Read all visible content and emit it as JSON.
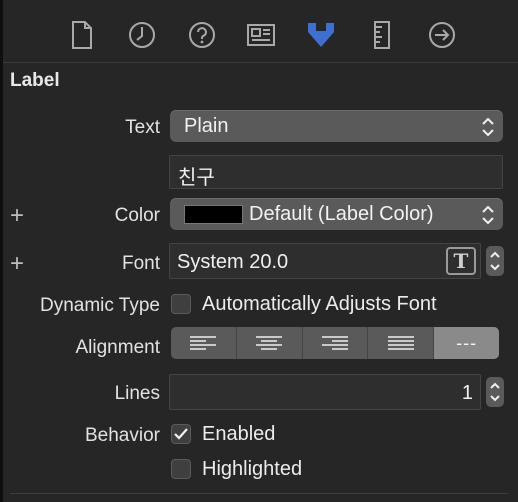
{
  "toolbar": {
    "icons": [
      "file-icon",
      "history-icon",
      "help-icon",
      "identity-icon",
      "attributes-icon",
      "size-icon",
      "connections-icon"
    ],
    "selected_color": "#3f6fd0"
  },
  "section": {
    "title": "Label"
  },
  "text_row": {
    "label": "Text",
    "value": "Plain",
    "content": "친구"
  },
  "color_row": {
    "label": "Color",
    "value": "Default (Label Color)",
    "swatch": "#000000"
  },
  "font_row": {
    "label": "Font",
    "value": "System 20.0"
  },
  "dynamic_type": {
    "label": "Dynamic Type",
    "checkbox_label": "Automatically Adjusts Font",
    "checked": false
  },
  "alignment": {
    "label": "Alignment",
    "options": [
      "left",
      "center",
      "right",
      "justified",
      "natural"
    ],
    "selected": "natural",
    "natural_glyph": "---"
  },
  "lines_row": {
    "label": "Lines",
    "value": "1"
  },
  "behavior": {
    "label": "Behavior",
    "enabled_label": "Enabled",
    "enabled_checked": true,
    "highlighted_label": "Highlighted",
    "highlighted_checked": false
  }
}
